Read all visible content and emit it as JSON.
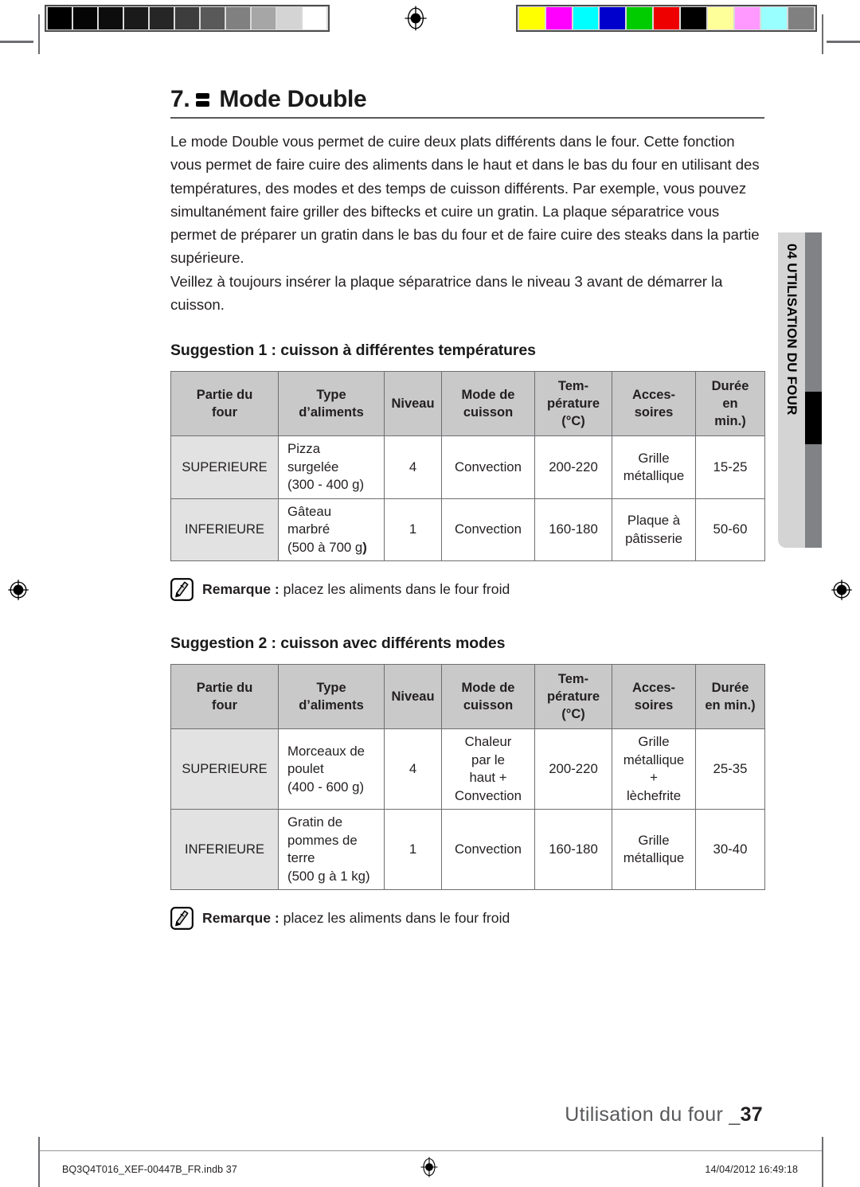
{
  "heading": {
    "number": "7.",
    "icon": "double-mode-icon",
    "title": "Mode Double"
  },
  "intro": "Le mode Double vous permet de cuire deux plats différents dans le four. Cette fonction vous permet de faire cuire des aliments dans le haut et dans le bas du four en utilisant des températures, des modes et des temps de cuisson différents. Par exemple, vous pouvez simultanément faire griller des biftecks et cuire un gratin. La plaque séparatrice vous permet de préparer un gratin dans le bas du four et de faire cuire des steaks dans la partie supérieure.\nVeillez à toujours insérer la plaque séparatrice dans le niveau 3 avant de démarrer la cuisson.",
  "suggestion1": {
    "heading": "Suggestion 1 : cuisson à différentes températures",
    "columns": [
      "Partie du\nfour",
      "Type\nd’aliments",
      "Niveau",
      "Mode de\ncuisson",
      "Tem-\npérature\n(°C)",
      "Acces-\nsoires",
      "Durée\nen\nmin.)"
    ],
    "rows": [
      {
        "part": "SUPERIEURE",
        "food": "Pizza\nsurgelée\n(300 - 400 g)",
        "food_bold_tail": "",
        "level": "4",
        "mode": "Convection",
        "temperature": "200-220",
        "accessory": "Grille\nmétallique",
        "duration": "15-25"
      },
      {
        "part": "INFERIEURE",
        "food": "Gâteau\nmarbré\n(500 à 700 g",
        "food_bold_tail": ")",
        "level": "1",
        "mode": "Convection",
        "temperature": "160-180",
        "accessory": "Plaque à\npâtisserie",
        "duration": "50-60"
      }
    ],
    "note_label": "Remarque :",
    "note_text": " placez les aliments dans le four froid",
    "note_icon": "pencil-note-icon"
  },
  "suggestion2": {
    "heading": "Suggestion 2 : cuisson avec différents modes",
    "columns": [
      "Partie du\nfour",
      "Type\nd’aliments",
      "Niveau",
      "Mode de\ncuisson",
      "Tem-\npérature\n(°C)",
      "Acces-\nsoires",
      "Durée\nen min.)"
    ],
    "rows": [
      {
        "part": "SUPERIEURE",
        "food": "Morceaux de\npoulet\n(400 - 600 g)",
        "food_bold_tail": "",
        "level": "4",
        "mode": "Chaleur\npar le\nhaut +\nConvection",
        "temperature": "200-220",
        "accessory": "Grille\nmétallique\n+\nlèchefrite",
        "duration": "25-35"
      },
      {
        "part": "INFERIEURE",
        "food": "Gratin de\npommes de\nterre\n(500 g à 1 kg)",
        "food_bold_tail": "",
        "level": "1",
        "mode": "Convection",
        "temperature": "160-180",
        "accessory": "Grille\nmétallique",
        "duration": "30-40"
      }
    ],
    "note_label": "Remarque :",
    "note_text": " placez les aliments dans le four froid",
    "note_icon": "pencil-note-icon"
  },
  "side_tab": {
    "label": "04 UTILISATION DU FOUR"
  },
  "page_footer": {
    "section_label": "Utilisation du four _",
    "page_number": "37",
    "file_name": "BQ3Q4T016_XEF-00447B_FR.indb   37",
    "timestamp": "14/04/2012   16:49:18"
  },
  "calibration": {
    "grayscale": [
      "#000000",
      "#050505",
      "#0d0d0d",
      "#1a1a1a",
      "#262626",
      "#3d3d3d",
      "#595959",
      "#808080",
      "#a6a6a6",
      "#d4d4d4",
      "#ffffff"
    ],
    "colors": [
      "#ffff00",
      "#ff00ff",
      "#00ffff",
      "#0000cc",
      "#00cc00",
      "#ee0000",
      "#000000",
      "#ffff99",
      "#ff99ff",
      "#99ffff",
      "#808080"
    ]
  }
}
